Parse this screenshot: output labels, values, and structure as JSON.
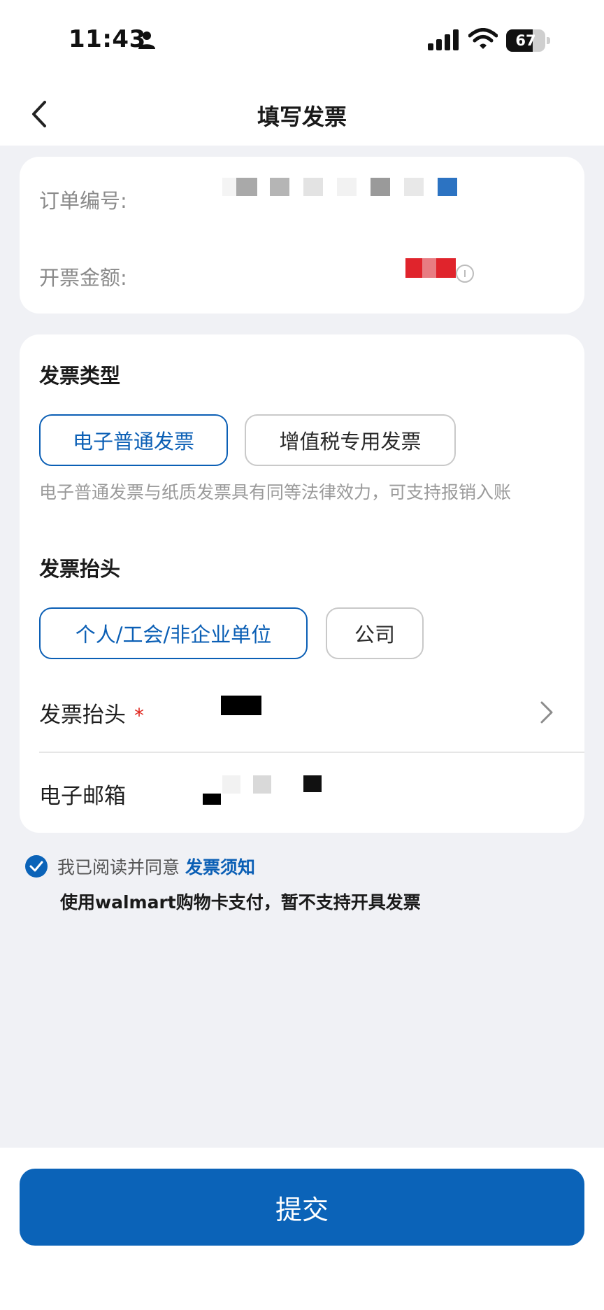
{
  "status_bar": {
    "time": "11:43",
    "battery": "67",
    "battery_level": 0.67
  },
  "nav": {
    "title": "填写发票"
  },
  "order": {
    "order_no_label": "订单编号:",
    "amount_label": "开票金额:"
  },
  "invoice_type": {
    "title": "发票类型",
    "options": [
      "电子普通发票",
      "增值税专用发票"
    ],
    "selected_index": 0,
    "hint": "电子普通发票与纸质发票具有同等法律效力，可支持报销入账"
  },
  "invoice_header": {
    "title": "发票抬头",
    "options": [
      "个人/工会/非企业单位",
      "公司"
    ],
    "selected_index": 0,
    "header_field_label": "发票抬头",
    "required_mark": "*",
    "email_field_label": "电子邮箱"
  },
  "agreement": {
    "text": "我已阅读并同意",
    "link": "发票须知",
    "notice": "使用walmart购物卡支付，暂不支持开具发票"
  },
  "submit": {
    "label": "提交"
  },
  "colors": {
    "primary": "#0B63B8",
    "required": "#E0241C",
    "background": "#F0F1F5"
  },
  "icons": [
    "person-icon",
    "signal-icon",
    "wifi-icon",
    "back-icon",
    "chevron-right-icon",
    "check-icon",
    "info-icon"
  ]
}
